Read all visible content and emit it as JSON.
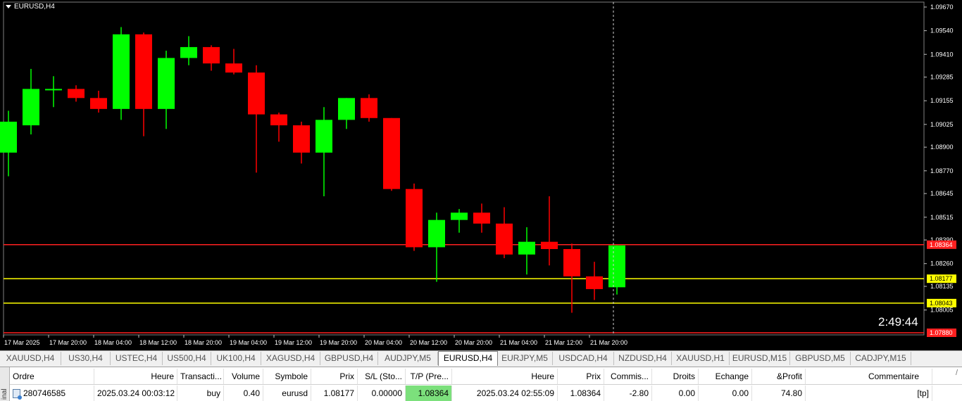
{
  "chart": {
    "symbol_label": "EURUSD,H4",
    "countdown": "2:49:44",
    "colors": {
      "bull": "#00ff00",
      "bear": "#ff0000",
      "background": "#000000",
      "tp_line": "#ff2020",
      "entry_line": "#ffff00",
      "sl_line": "#ffff00"
    },
    "price_axis": [
      "1.09670",
      "1.09540",
      "1.09410",
      "1.09285",
      "1.09155",
      "1.09025",
      "1.08900",
      "1.08770",
      "1.08645",
      "1.08515",
      "1.08390",
      "1.08260",
      "1.08135",
      "1.08005"
    ],
    "price_tags": [
      {
        "label": "1.08364",
        "price": 1.08364,
        "type": "tp"
      },
      {
        "label": "1.08177",
        "price": 1.08177,
        "type": "entry"
      },
      {
        "label": "1.08043",
        "price": 1.08043,
        "type": "sl"
      },
      {
        "label": "1.07880",
        "price": 1.0788,
        "type": "bottom"
      }
    ],
    "time_axis": [
      "17 Mar 2025",
      "17 Mar 20:00",
      "18 Mar 04:00",
      "18 Mar 12:00",
      "18 Mar 20:00",
      "19 Mar 04:00",
      "19 Mar 12:00",
      "19 Mar 20:00",
      "20 Mar 04:00",
      "20 Mar 12:00",
      "20 Mar 20:00",
      "21 Mar 04:00",
      "21 Mar 12:00",
      "21 Mar 20:00"
    ]
  },
  "chart_data": {
    "type": "candlestick",
    "title": "EURUSD,H4",
    "ylim": [
      1.0788,
      1.0967
    ],
    "candles": [
      {
        "o": 1.0887,
        "h": 1.091,
        "l": 1.0874,
        "c": 1.0904
      },
      {
        "o": 1.0902,
        "h": 1.0933,
        "l": 1.0897,
        "c": 1.0922
      },
      {
        "o": 1.0922,
        "h": 1.0929,
        "l": 1.0912,
        "c": 1.0922
      },
      {
        "o": 1.0922,
        "h": 1.0924,
        "l": 1.0915,
        "c": 1.0917
      },
      {
        "o": 1.0917,
        "h": 1.0921,
        "l": 1.0909,
        "c": 1.0911
      },
      {
        "o": 1.0911,
        "h": 1.0956,
        "l": 1.0905,
        "c": 1.0952
      },
      {
        "o": 1.0952,
        "h": 1.0953,
        "l": 1.0896,
        "c": 1.0911
      },
      {
        "o": 1.0911,
        "h": 1.0943,
        "l": 1.09,
        "c": 1.0939
      },
      {
        "o": 1.0939,
        "h": 1.0951,
        "l": 1.0935,
        "c": 1.0945
      },
      {
        "o": 1.0945,
        "h": 1.0946,
        "l": 1.0932,
        "c": 1.0936
      },
      {
        "o": 1.0936,
        "h": 1.0944,
        "l": 1.093,
        "c": 1.0931
      },
      {
        "o": 1.0931,
        "h": 1.0935,
        "l": 1.0876,
        "c": 1.0908
      },
      {
        "o": 1.0908,
        "h": 1.0909,
        "l": 1.0893,
        "c": 1.0902
      },
      {
        "o": 1.0902,
        "h": 1.0904,
        "l": 1.0881,
        "c": 1.0887
      },
      {
        "o": 1.0887,
        "h": 1.0912,
        "l": 1.0863,
        "c": 1.0905
      },
      {
        "o": 1.0905,
        "h": 1.0917,
        "l": 1.09,
        "c": 1.0917
      },
      {
        "o": 1.0917,
        "h": 1.0919,
        "l": 1.0904,
        "c": 1.0906
      },
      {
        "o": 1.0906,
        "h": 1.0906,
        "l": 1.0866,
        "c": 1.0867
      },
      {
        "o": 1.0867,
        "h": 1.087,
        "l": 1.0833,
        "c": 1.0835
      },
      {
        "o": 1.0835,
        "h": 1.0854,
        "l": 1.0816,
        "c": 1.085
      },
      {
        "o": 1.085,
        "h": 1.0856,
        "l": 1.0843,
        "c": 1.0854
      },
      {
        "o": 1.0854,
        "h": 1.0859,
        "l": 1.0843,
        "c": 1.0848
      },
      {
        "o": 1.0848,
        "h": 1.0857,
        "l": 1.0829,
        "c": 1.0831
      },
      {
        "o": 1.0831,
        "h": 1.0846,
        "l": 1.082,
        "c": 1.0838
      },
      {
        "o": 1.0838,
        "h": 1.0863,
        "l": 1.0825,
        "c": 1.0834
      },
      {
        "o": 1.0834,
        "h": 1.0837,
        "l": 1.0799,
        "c": 1.0819
      },
      {
        "o": 1.0819,
        "h": 1.0827,
        "l": 1.0806,
        "c": 1.0812
      },
      {
        "o": 1.0813,
        "h": 1.0836,
        "l": 1.0809,
        "c": 1.0836
      }
    ]
  },
  "tabs": [
    {
      "label": "XAUUSD,H4",
      "active": false
    },
    {
      "label": "US30,H4",
      "active": false
    },
    {
      "label": "USTEC,H4",
      "active": false
    },
    {
      "label": "US500,H4",
      "active": false
    },
    {
      "label": "UK100,H4",
      "active": false
    },
    {
      "label": "XAGUSD,H4",
      "active": false
    },
    {
      "label": "GBPUSD,H4",
      "active": false
    },
    {
      "label": "AUDJPY,M5",
      "active": false
    },
    {
      "label": "EURUSD,H4",
      "active": true
    },
    {
      "label": "EURJPY,M5",
      "active": false
    },
    {
      "label": "USDCAD,H4",
      "active": false
    },
    {
      "label": "NZDUSD,H4",
      "active": false
    },
    {
      "label": "XAUUSD,H1",
      "active": false
    },
    {
      "label": "EURUSD,M15",
      "active": false
    },
    {
      "label": "GBPUSD,M5",
      "active": false
    },
    {
      "label": "CADJPY,M15",
      "active": false
    }
  ],
  "terminal": {
    "side_label": "inal",
    "columns": [
      "Ordre",
      "Heure",
      "Transacti...",
      "Volume",
      "Symbole",
      "Prix",
      "S/L (Sto...",
      "T/P (Pre...",
      "Heure",
      "Prix",
      "Commis...",
      "Droits",
      "Echange",
      "&Profit",
      "Commentaire"
    ],
    "sort_glyph": "/",
    "row": {
      "ordre": "280746585",
      "heure_open": "2025.03.24 00:03:12",
      "type": "buy",
      "volume": "0.40",
      "symbole": "eurusd",
      "prix_open": "1.08177",
      "sl": "0.00000",
      "tp": "1.08364",
      "heure_close": "2025.03.24 02:55:09",
      "prix_close": "1.08364",
      "commission": "-2.80",
      "droits": "0.00",
      "echange": "0.00",
      "profit": "74.80",
      "commentaire": "[tp]"
    }
  }
}
